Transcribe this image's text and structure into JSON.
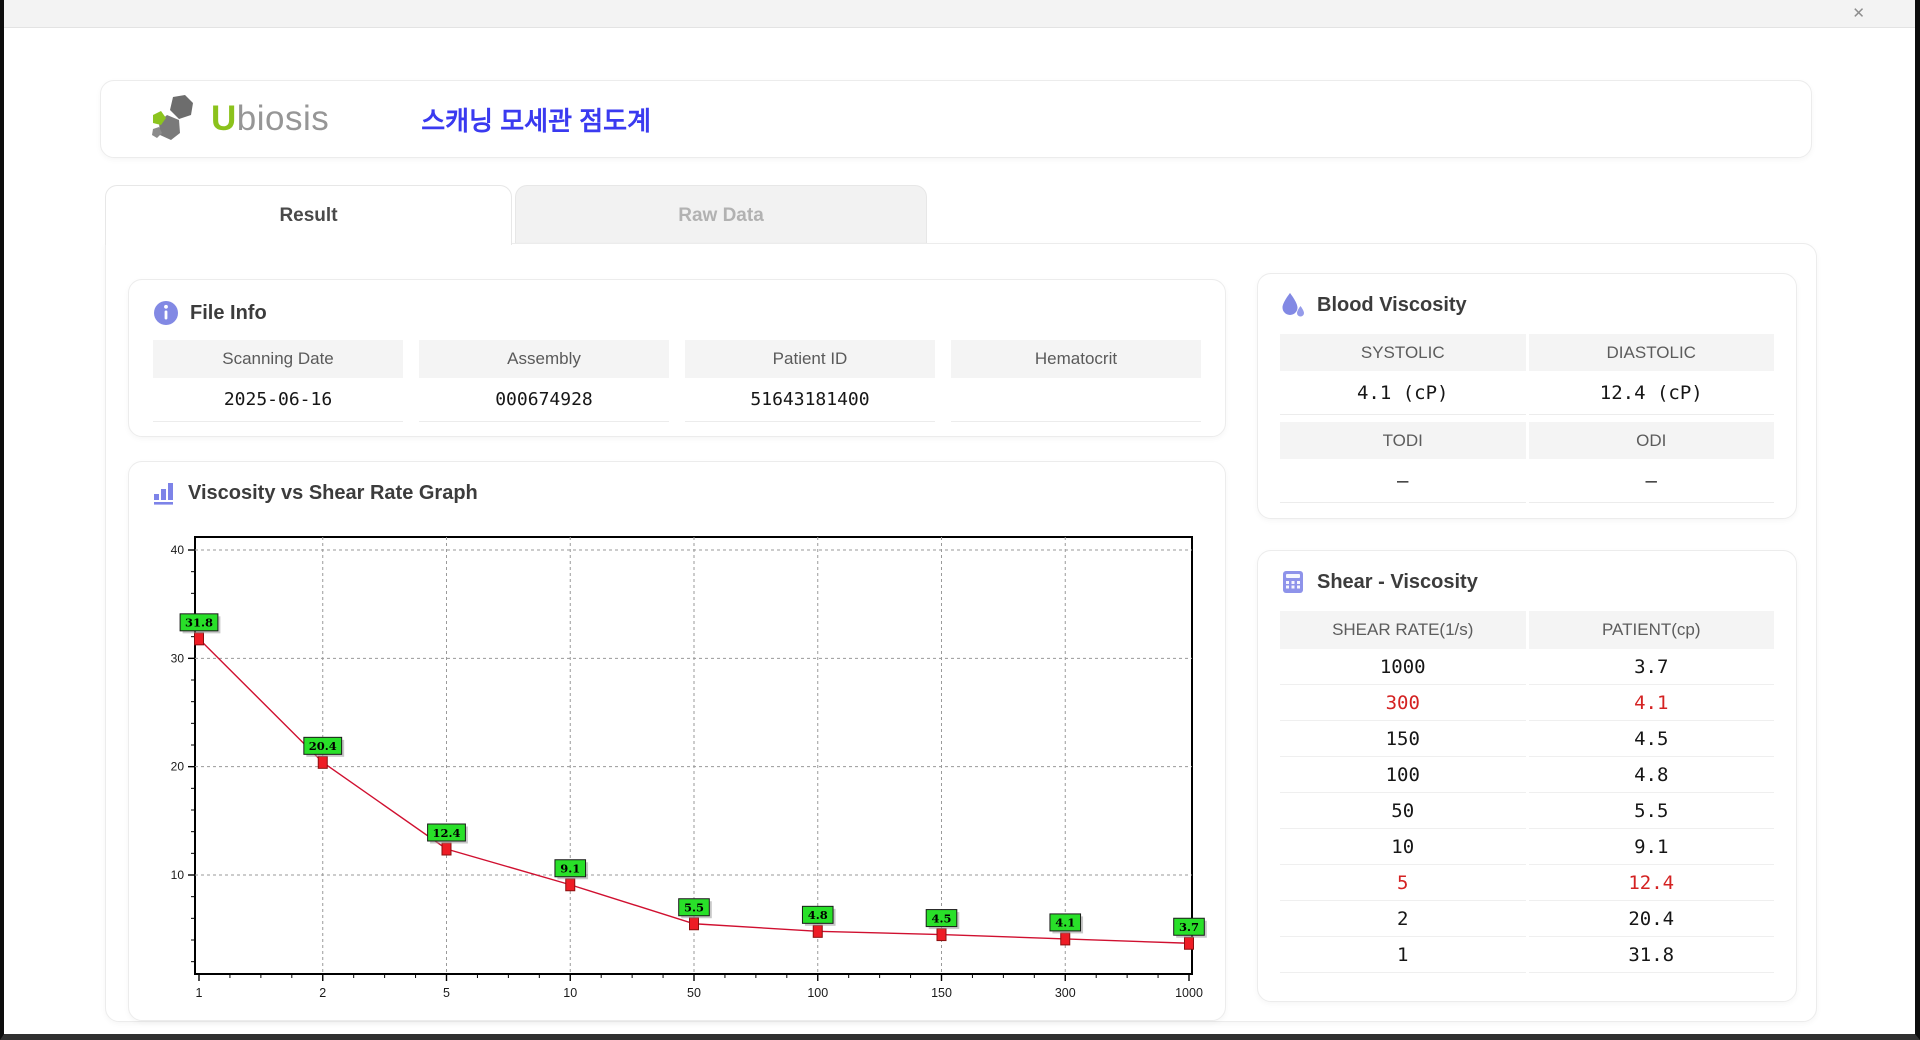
{
  "window": {
    "close_icon": "✕"
  },
  "header": {
    "logo_first_letter": "U",
    "logo_rest": "biosis",
    "app_title": "스캐닝 모세관 점도계"
  },
  "tabs": {
    "result": "Result",
    "raw_data": "Raw Data"
  },
  "file_info": {
    "title": "File Info",
    "fields": [
      {
        "label": "Scanning Date",
        "value": "2025-06-16"
      },
      {
        "label": "Assembly",
        "value": "000674928"
      },
      {
        "label": "Patient ID",
        "value": "51643181400"
      },
      {
        "label": "Hematocrit",
        "value": ""
      }
    ]
  },
  "blood_viscosity": {
    "title": "Blood Viscosity",
    "groups": [
      {
        "cells": [
          {
            "label": "SYSTOLIC",
            "value": "4.1 (cP)"
          },
          {
            "label": "DIASTOLIC",
            "value": "12.4 (cP)"
          }
        ]
      },
      {
        "cells": [
          {
            "label": "TODI",
            "value": "–"
          },
          {
            "label": "ODI",
            "value": "–"
          }
        ]
      }
    ]
  },
  "graph": {
    "title": "Viscosity vs Shear Rate Graph"
  },
  "shear_viscosity": {
    "title": "Shear - Viscosity",
    "columns": [
      "SHEAR RATE(1/s)",
      "PATIENT(cp)"
    ],
    "rows": [
      {
        "shear_rate": "1000",
        "patient": "3.7",
        "highlight": false
      },
      {
        "shear_rate": "300",
        "patient": "4.1",
        "highlight": true
      },
      {
        "shear_rate": "150",
        "patient": "4.5",
        "highlight": false
      },
      {
        "shear_rate": "100",
        "patient": "4.8",
        "highlight": false
      },
      {
        "shear_rate": "50",
        "patient": "5.5",
        "highlight": false
      },
      {
        "shear_rate": "10",
        "patient": "9.1",
        "highlight": false
      },
      {
        "shear_rate": "5",
        "patient": "12.4",
        "highlight": true
      },
      {
        "shear_rate": "2",
        "patient": "20.4",
        "highlight": false
      },
      {
        "shear_rate": "1",
        "patient": "31.8",
        "highlight": false
      }
    ]
  },
  "chart_data": {
    "type": "line",
    "title": "Viscosity vs Shear Rate Graph",
    "x": [
      1,
      2,
      5,
      10,
      50,
      100,
      150,
      300,
      1000
    ],
    "x_scale": "categorical-log",
    "series": [
      {
        "name": "PATIENT(cp)",
        "values": [
          31.8,
          20.4,
          12.4,
          9.1,
          5.5,
          4.8,
          4.5,
          4.1,
          3.7
        ]
      }
    ],
    "point_labels": [
      "31.8",
      "20.4",
      "12.4",
      "9.1",
      "5.5",
      "4.8",
      "4.5",
      "4.1",
      "3.7"
    ],
    "xlabel": "",
    "ylabel": "",
    "ylim": [
      0,
      41
    ],
    "yticks": [
      10,
      20,
      30,
      40
    ],
    "grid": true,
    "legend": false,
    "colors": {
      "line": "#d01030",
      "marker_fill": "#ee1c25",
      "marker_stroke": "#8a0f0f",
      "label_bg": "#29e029",
      "label_border": "#1a1a1a",
      "grid": "#9a9a9a"
    }
  },
  "colors": {
    "accent_blue": "#3a3af0",
    "logo_green": "#8bc21c",
    "icon_purple": "#8289e4",
    "highlight_red": "#d42222"
  }
}
